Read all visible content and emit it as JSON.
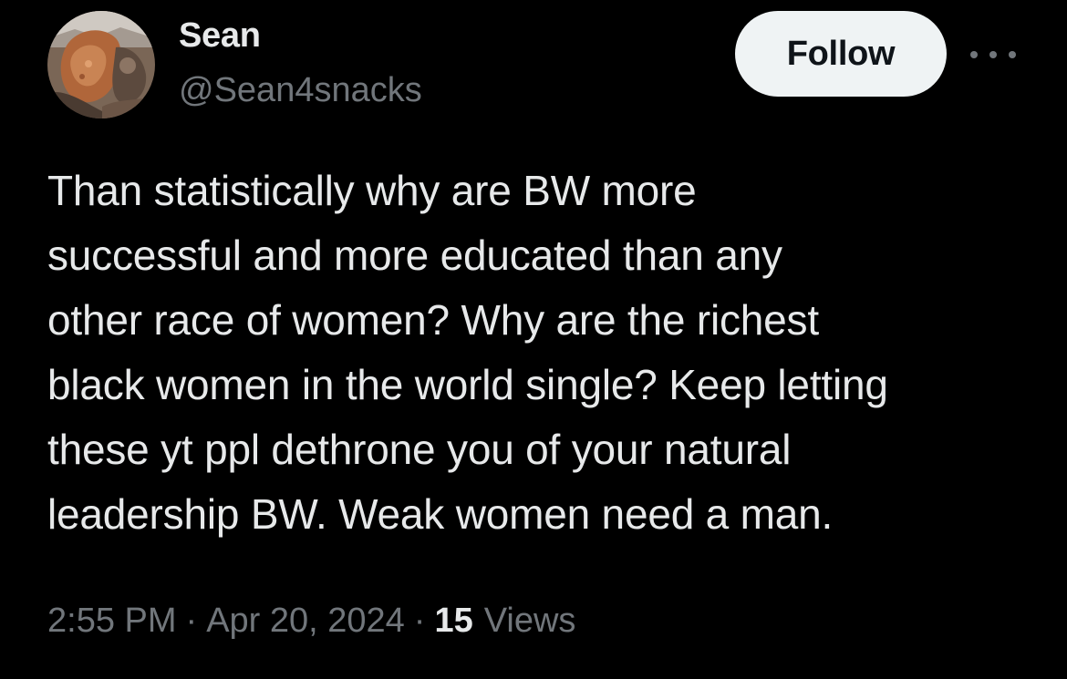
{
  "author": {
    "display_name": "Sean",
    "handle": "@Sean4snacks",
    "avatar": "avatar-image"
  },
  "actions": {
    "follow_label": "Follow",
    "more_icon": "more-horizontal-icon"
  },
  "tweet": {
    "text": "Than statistically why are BW more\nsuccessful and more educated than any\nother race of women? Why are the richest\nblack women in the world single? Keep letting\nthese yt ppl dethrone you of your natural\nleadership BW. Weak women need a man."
  },
  "meta": {
    "time": "2:55 PM",
    "separator": "·",
    "date": "Apr 20, 2024",
    "views_count": "15",
    "views_label": "Views"
  },
  "colors": {
    "background": "#000000",
    "primary_text": "#e7e9ea",
    "secondary_text": "#71767b",
    "follow_button_bg": "#eff3f4",
    "follow_button_text": "#0f1419"
  }
}
